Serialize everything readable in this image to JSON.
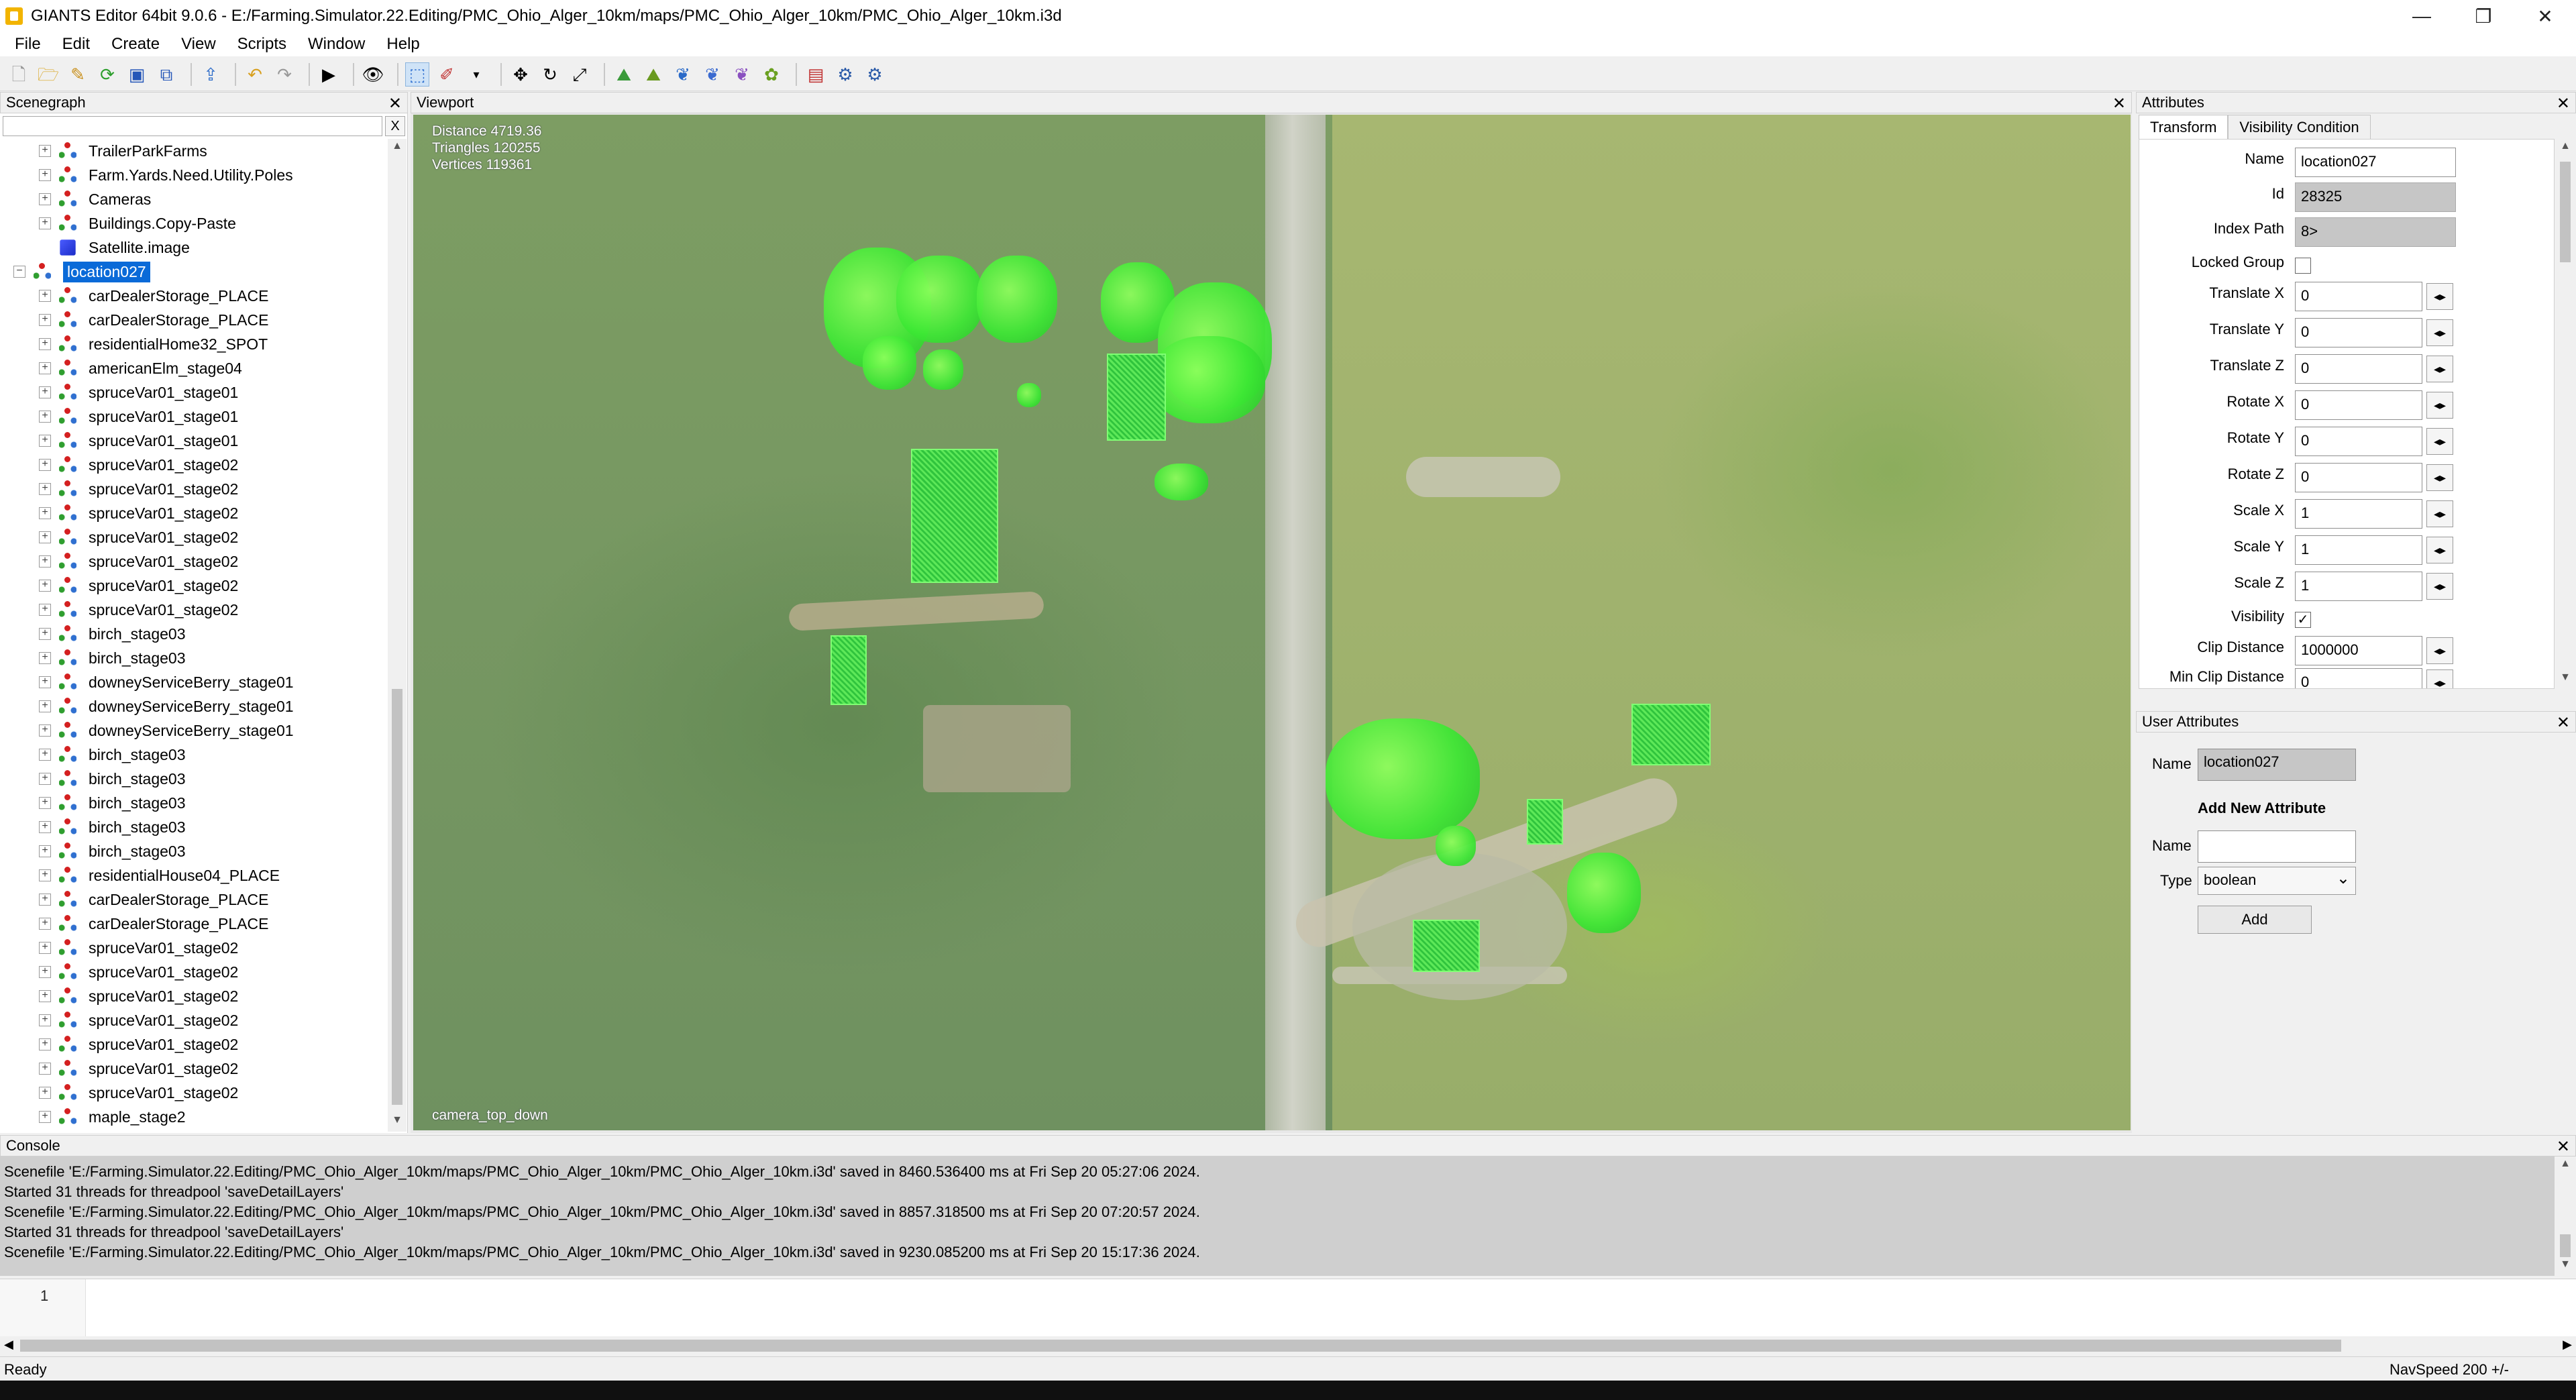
{
  "window": {
    "title": "GIANTS Editor 64bit 9.0.6 - E:/Farming.Simulator.22.Editing/PMC_Ohio_Alger_10km/maps/PMC_Ohio_Alger_10km/PMC_Ohio_Alger_10km.i3d",
    "minimize": "—",
    "restore": "❐",
    "close": "✕"
  },
  "menu": [
    "File",
    "Edit",
    "Create",
    "View",
    "Scripts",
    "Window",
    "Help"
  ],
  "toolbar": {
    "icons": [
      "new-file-icon",
      "open-folder-icon",
      "edit-icon",
      "refresh-icon",
      "save-icon",
      "save-all-icon",
      "export-icon",
      "undo-icon",
      "redo-icon",
      "play-icon",
      "eye-icon",
      "select-icon",
      "brush-icon",
      "dropdown-icon",
      "move-icon",
      "rotate-icon",
      "scale-icon",
      "terrain-sculpt-icon",
      "terrain-paint-icon",
      "foliage-paint-icon",
      "texture-paint-icon",
      "height-paint-icon",
      "decal-paint-icon",
      "layers-icon",
      "settings-icon",
      "render-icon"
    ]
  },
  "scenegraph": {
    "title": "Scenegraph",
    "close": "✕",
    "search_value": "",
    "clear_label": "X",
    "items": [
      {
        "label": "TrailerParkFarms",
        "expander": "+",
        "icon": "tg",
        "indent": 1
      },
      {
        "label": "Farm.Yards.Need.Utility.Poles",
        "expander": "+",
        "icon": "tg",
        "indent": 1
      },
      {
        "label": "Cameras",
        "expander": "+",
        "icon": "tg",
        "indent": 1
      },
      {
        "label": "Buildings.Copy-Paste",
        "expander": "+",
        "icon": "tg",
        "indent": 1
      },
      {
        "label": "Satellite.image",
        "expander": "",
        "icon": "cube",
        "indent": 1
      },
      {
        "label": "location027",
        "expander": "−",
        "icon": "tg",
        "indent": 0,
        "selected": true
      },
      {
        "label": "carDealerStorage_PLACE",
        "expander": "+",
        "icon": "tg",
        "indent": 1
      },
      {
        "label": "carDealerStorage_PLACE",
        "expander": "+",
        "icon": "tg",
        "indent": 1
      },
      {
        "label": "residentialHome32_SPOT",
        "expander": "+",
        "icon": "tg",
        "indent": 1
      },
      {
        "label": "americanElm_stage04",
        "expander": "+",
        "icon": "tg",
        "indent": 1
      },
      {
        "label": "spruceVar01_stage01",
        "expander": "+",
        "icon": "tg",
        "indent": 1
      },
      {
        "label": "spruceVar01_stage01",
        "expander": "+",
        "icon": "tg",
        "indent": 1
      },
      {
        "label": "spruceVar01_stage01",
        "expander": "+",
        "icon": "tg",
        "indent": 1
      },
      {
        "label": "spruceVar01_stage02",
        "expander": "+",
        "icon": "tg",
        "indent": 1
      },
      {
        "label": "spruceVar01_stage02",
        "expander": "+",
        "icon": "tg",
        "indent": 1
      },
      {
        "label": "spruceVar01_stage02",
        "expander": "+",
        "icon": "tg",
        "indent": 1
      },
      {
        "label": "spruceVar01_stage02",
        "expander": "+",
        "icon": "tg",
        "indent": 1
      },
      {
        "label": "spruceVar01_stage02",
        "expander": "+",
        "icon": "tg",
        "indent": 1
      },
      {
        "label": "spruceVar01_stage02",
        "expander": "+",
        "icon": "tg",
        "indent": 1
      },
      {
        "label": "spruceVar01_stage02",
        "expander": "+",
        "icon": "tg",
        "indent": 1
      },
      {
        "label": "birch_stage03",
        "expander": "+",
        "icon": "tg",
        "indent": 1
      },
      {
        "label": "birch_stage03",
        "expander": "+",
        "icon": "tg",
        "indent": 1
      },
      {
        "label": "downeyServiceBerry_stage01",
        "expander": "+",
        "icon": "tg",
        "indent": 1
      },
      {
        "label": "downeyServiceBerry_stage01",
        "expander": "+",
        "icon": "tg",
        "indent": 1
      },
      {
        "label": "downeyServiceBerry_stage01",
        "expander": "+",
        "icon": "tg",
        "indent": 1
      },
      {
        "label": "birch_stage03",
        "expander": "+",
        "icon": "tg",
        "indent": 1
      },
      {
        "label": "birch_stage03",
        "expander": "+",
        "icon": "tg",
        "indent": 1
      },
      {
        "label": "birch_stage03",
        "expander": "+",
        "icon": "tg",
        "indent": 1
      },
      {
        "label": "birch_stage03",
        "expander": "+",
        "icon": "tg",
        "indent": 1
      },
      {
        "label": "birch_stage03",
        "expander": "+",
        "icon": "tg",
        "indent": 1
      },
      {
        "label": "residentialHouse04_PLACE",
        "expander": "+",
        "icon": "tg",
        "indent": 1
      },
      {
        "label": "carDealerStorage_PLACE",
        "expander": "+",
        "icon": "tg",
        "indent": 1
      },
      {
        "label": "carDealerStorage_PLACE",
        "expander": "+",
        "icon": "tg",
        "indent": 1
      },
      {
        "label": "spruceVar01_stage02",
        "expander": "+",
        "icon": "tg",
        "indent": 1
      },
      {
        "label": "spruceVar01_stage02",
        "expander": "+",
        "icon": "tg",
        "indent": 1
      },
      {
        "label": "spruceVar01_stage02",
        "expander": "+",
        "icon": "tg",
        "indent": 1
      },
      {
        "label": "spruceVar01_stage02",
        "expander": "+",
        "icon": "tg",
        "indent": 1
      },
      {
        "label": "spruceVar01_stage02",
        "expander": "+",
        "icon": "tg",
        "indent": 1
      },
      {
        "label": "spruceVar01_stage02",
        "expander": "+",
        "icon": "tg",
        "indent": 1
      },
      {
        "label": "spruceVar01_stage02",
        "expander": "+",
        "icon": "tg",
        "indent": 1
      },
      {
        "label": "maple_stage2",
        "expander": "+",
        "icon": "tg",
        "indent": 1
      }
    ]
  },
  "viewport": {
    "title": "Viewport",
    "close": "✕",
    "distance": "Distance 4719.36",
    "triangles": "Triangles 120255",
    "vertices": "Vertices 119361",
    "camera": "camera_top_down"
  },
  "attributes": {
    "title": "Attributes",
    "close": "✕",
    "tabs": [
      "Transform",
      "Visibility Condition"
    ],
    "fields": {
      "name_label": "Name",
      "name_value": "location027",
      "id_label": "Id",
      "id_value": "28325",
      "index_path_label": "Index Path",
      "index_path_value": "8>",
      "locked_group_label": "Locked Group",
      "locked_group_checked": "",
      "translate_x_label": "Translate X",
      "translate_x": "0",
      "translate_y_label": "Translate Y",
      "translate_y": "0",
      "translate_z_label": "Translate Z",
      "translate_z": "0",
      "rotate_x_label": "Rotate X",
      "rotate_x": "0",
      "rotate_y_label": "Rotate Y",
      "rotate_y": "0",
      "rotate_z_label": "Rotate Z",
      "rotate_z": "0",
      "scale_x_label": "Scale X",
      "scale_x": "1",
      "scale_y_label": "Scale Y",
      "scale_y": "1",
      "scale_z_label": "Scale Z",
      "scale_z": "1",
      "visibility_label": "Visibility",
      "visibility_checked": "✓",
      "clip_distance_label": "Clip Distance",
      "clip_distance": "1000000",
      "min_clip_distance_label": "Min Clip Distance",
      "min_clip_distance": "0",
      "spin": "◂▸"
    }
  },
  "user_attributes": {
    "title": "User Attributes",
    "close": "✕",
    "name_label": "Name",
    "name_value": "location027",
    "add_heading": "Add New Attribute",
    "new_name_label": "Name",
    "new_name_value": "",
    "type_label": "Type",
    "type_value": "boolean",
    "add_button": "Add"
  },
  "console": {
    "title": "Console",
    "close": "✕",
    "lines": [
      "Scenefile 'E:/Farming.Simulator.22.Editing/PMC_Ohio_Alger_10km/maps/PMC_Ohio_Alger_10km/PMC_Ohio_Alger_10km.i3d' saved in 8460.536400 ms at Fri Sep 20 05:27:06 2024.",
      "Started 31 threads for threadpool 'saveDetailLayers'",
      "Scenefile 'E:/Farming.Simulator.22.Editing/PMC_Ohio_Alger_10km/maps/PMC_Ohio_Alger_10km/PMC_Ohio_Alger_10km.i3d' saved in 8857.318500 ms at Fri Sep 20 07:20:57 2024.",
      "Started 31 threads for threadpool 'saveDetailLayers'",
      "Scenefile 'E:/Farming.Simulator.22.Editing/PMC_Ohio_Alger_10km/maps/PMC_Ohio_Alger_10km/PMC_Ohio_Alger_10km.i3d' saved in 9230.085200 ms at Fri Sep 20 15:17:36 2024."
    ],
    "line_number": "1",
    "input_value": ""
  },
  "status": {
    "left": "Ready",
    "right": "NavSpeed 200 +/-"
  }
}
